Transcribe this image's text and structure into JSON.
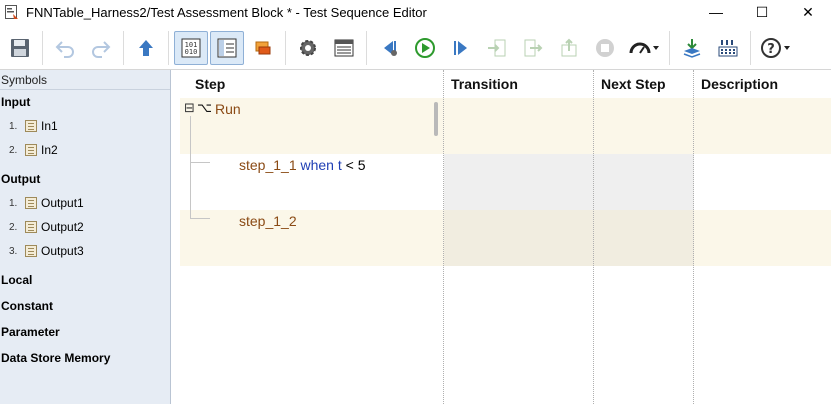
{
  "window": {
    "title": "FNNTable_Harness2/Test Assessment Block * - Test Sequence Editor",
    "controls": {
      "minimize": "—",
      "maximize": "☐",
      "close": "✕"
    }
  },
  "toolbar": {
    "icons": [
      "save-icon",
      "undo-icon",
      "redo-icon",
      "up-arrow-icon",
      "binary-data-icon",
      "symbol-pane-icon",
      "library-icon",
      "settings-gear-icon",
      "table-view-icon",
      "step-back-icon",
      "run-play-icon",
      "step-forward-icon",
      "enter-step-icon",
      "exit-step-icon",
      "step-out-icon",
      "stop-icon",
      "pacing-gauge-icon",
      "update-model-icon",
      "signal-grid-icon",
      "help-icon"
    ]
  },
  "symbols": {
    "header": "Symbols",
    "groups": [
      {
        "label": "Input",
        "items": [
          {
            "num": "1.",
            "label": "In1"
          },
          {
            "num": "2.",
            "label": "In2"
          }
        ]
      },
      {
        "label": "Output",
        "items": [
          {
            "num": "1.",
            "label": "Output1"
          },
          {
            "num": "2.",
            "label": "Output2"
          },
          {
            "num": "3.",
            "label": "Output3"
          }
        ]
      },
      {
        "label": "Local"
      },
      {
        "label": "Constant"
      },
      {
        "label": "Parameter"
      },
      {
        "label": "Data Store Memory"
      }
    ]
  },
  "table": {
    "columns": [
      "Step",
      "Transition",
      "Next Step",
      "Description"
    ],
    "rows": [
      {
        "toggle": "⊟",
        "prefix": "⌥",
        "name": "Run"
      },
      {
        "name": "step_1_1",
        "keyword": "when",
        "condition": "t < 5"
      },
      {
        "name": "step_1_2"
      }
    ]
  },
  "colors": {
    "state_name": "#8a4a14",
    "keyword": "#1f3fb4",
    "row_alt": "#fbf7e9",
    "symbols_bg": "#e6ecf4",
    "run_green": "#2e9a2e"
  }
}
